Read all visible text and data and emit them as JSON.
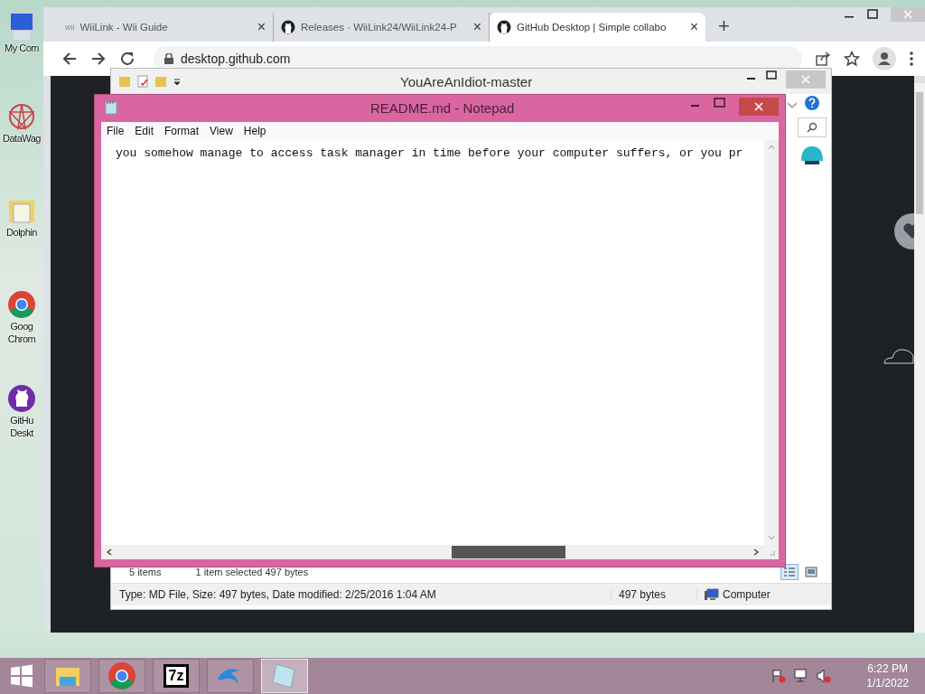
{
  "desktop_icons": [
    {
      "kind": "computer",
      "label": "My Com"
    },
    {
      "kind": "star",
      "label": "DataWag"
    },
    {
      "kind": "folder",
      "label": "Dolphin"
    },
    {
      "kind": "chrome",
      "label": "Goog Chrom"
    },
    {
      "kind": "github",
      "label": "GitHu Deskt"
    }
  ],
  "browser": {
    "tabs": [
      {
        "favicon": {
          "kind": "text",
          "text": "wii"
        },
        "label": "WiiLink - Wii Guide",
        "close": "×",
        "selected": false
      },
      {
        "favicon": {
          "kind": "github"
        },
        "label": "Releases · WiiLink24/WiiLink24-P",
        "close": "×",
        "selected": false
      },
      {
        "favicon": {
          "kind": "github"
        },
        "label": "GitHub Desktop | Simple collabo",
        "close": "×",
        "selected": true
      }
    ],
    "new_tab": "+",
    "url": "desktop.github.com"
  },
  "explorer": {
    "title": "YouAreAnIdiot-master",
    "status": {
      "items": "5 items",
      "selection": "1 item selected  497 bytes"
    },
    "details": {
      "info": "Type: MD File, Size: 497 bytes, Date modified: 2/25/2016 1:04 AM",
      "size": "497 bytes",
      "location": "Computer"
    },
    "views": [
      {
        "kind": "details",
        "selected": true
      },
      {
        "kind": "tiles",
        "selected": false
      }
    ]
  },
  "notepad": {
    "title": "README.md - Notepad",
    "menu": [
      "File",
      "Edit",
      "Format",
      "View",
      "Help"
    ],
    "text": "you somehow manage to access task manager in time before your computer suffers, or you pr"
  },
  "taskbar": {
    "apps": [
      {
        "kind": "folder",
        "selected": false
      },
      {
        "kind": "chrome",
        "selected": false
      },
      {
        "kind": "sevenzip",
        "selected": false,
        "text": "7z"
      },
      {
        "kind": "dolphin",
        "selected": false
      },
      {
        "kind": "notepad",
        "selected": true
      }
    ],
    "time": "6:22 PM",
    "date": "1/1/2022"
  }
}
